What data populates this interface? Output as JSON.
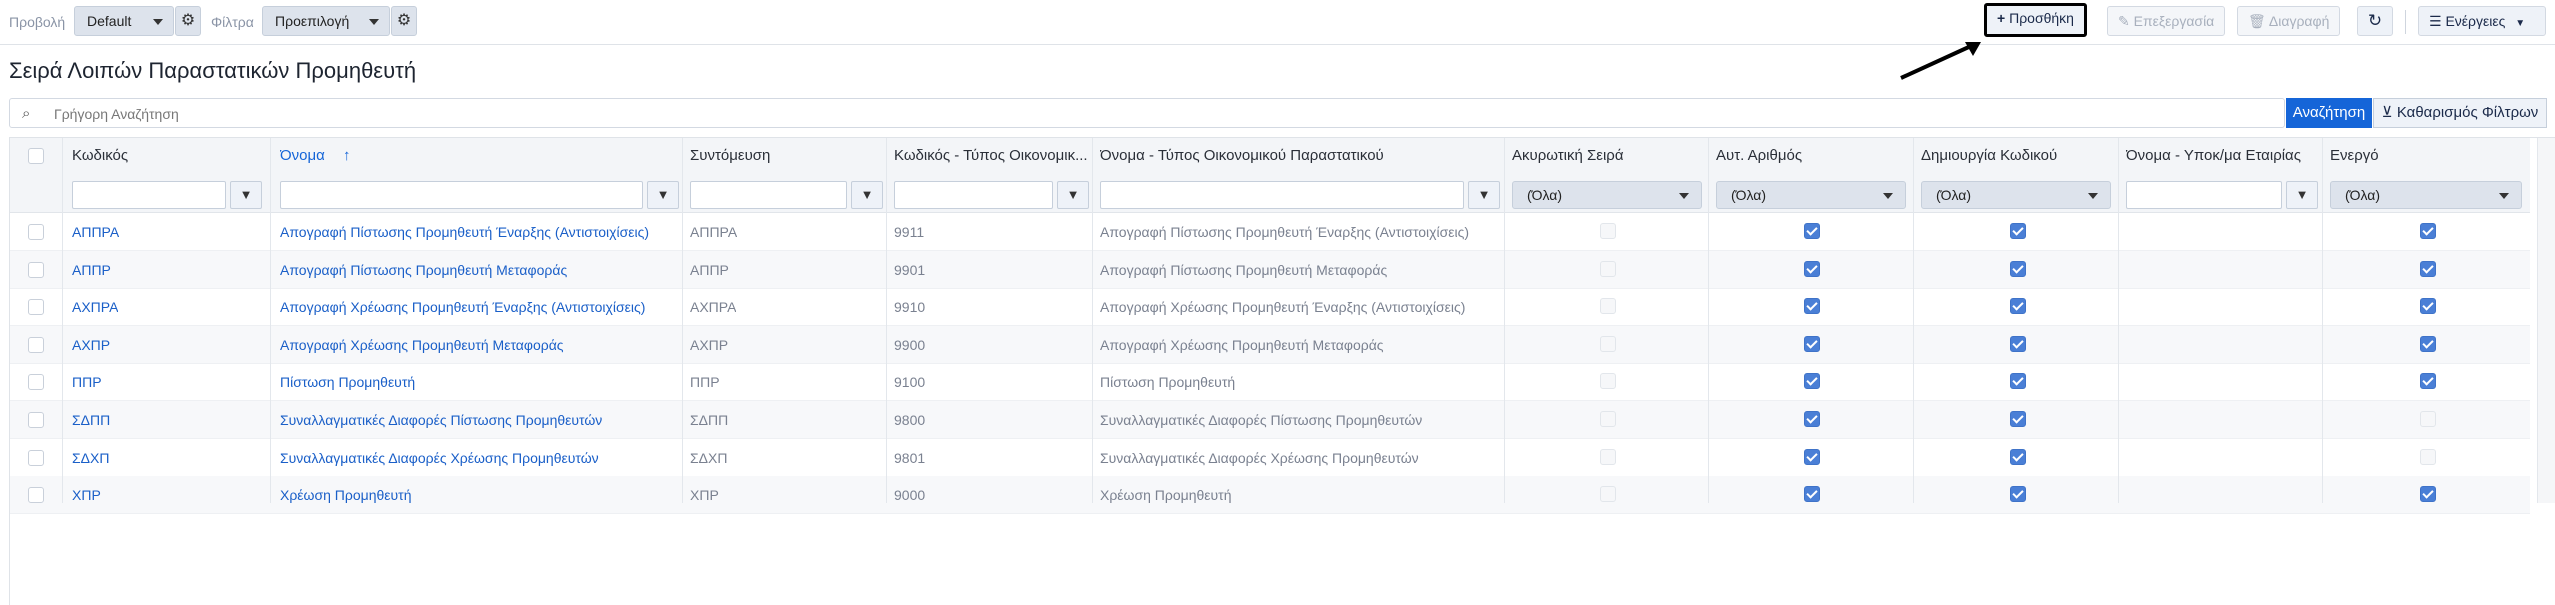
{
  "toolbar": {
    "view_label": "Προβολή",
    "view_value": "Default",
    "filters_label": "Φίλτρα",
    "filters_value": "Προεπιλογή",
    "add_label": "Προσθήκη",
    "edit_label": "Επεξεργασία",
    "delete_label": "Διαγραφή",
    "actions_label": "Ενέργειες"
  },
  "page": {
    "title": "Σειρά Λοιπών Παραστατικών Προμηθευτή"
  },
  "search": {
    "placeholder": "Γρήγορη Αναζήτηση",
    "search_button": "Αναζήτηση",
    "clear_filters_button": "Καθαρισμός Φίλτρων"
  },
  "grid": {
    "columns": [
      "Κωδικός",
      "Όνομα",
      "Συντόμευση",
      "Κωδικός - Τύπος Οικονομικ...",
      "Όνομα - Τύπος Οικονομικού Παραστατικού",
      "Ακυρωτική Σειρά",
      "Αυτ. Αριθμός",
      "Δημιουργία Κωδικού",
      "Όνομα - Υποκ/μα Εταιρίας",
      "Ενεργό"
    ],
    "sort_indicator": "↑",
    "filter_all": "(Όλα)",
    "rows": [
      {
        "code": "ΑΠΠΡΑ",
        "name": "Απογραφή Πίστωσης Προμηθευτή Έναρξης (Αντιστοιχίσεις)",
        "short": "ΑΠΠΡΑ",
        "type_code": "9911",
        "type_name": "Απογραφή Πίστωσης Προμηθευτή Έναρξης (Αντιστοιχίσεις)",
        "cancel": false,
        "auto": true,
        "create": true,
        "active": true
      },
      {
        "code": "ΑΠΠΡ",
        "name": "Απογραφή Πίστωσης Προμηθευτή Μεταφοράς",
        "short": "ΑΠΠΡ",
        "type_code": "9901",
        "type_name": "Απογραφή Πίστωσης Προμηθευτή Μεταφοράς",
        "cancel": false,
        "auto": true,
        "create": true,
        "active": true
      },
      {
        "code": "ΑΧΠΡΑ",
        "name": "Απογραφή Χρέωσης Προμηθευτή Έναρξης (Αντιστοιχίσεις)",
        "short": "ΑΧΠΡΑ",
        "type_code": "9910",
        "type_name": "Απογραφή Χρέωσης Προμηθευτή Έναρξης (Αντιστοιχίσεις)",
        "cancel": false,
        "auto": true,
        "create": true,
        "active": true
      },
      {
        "code": "ΑΧΠΡ",
        "name": "Απογραφή Χρέωσης Προμηθευτή Μεταφοράς",
        "short": "ΑΧΠΡ",
        "type_code": "9900",
        "type_name": "Απογραφή Χρέωσης Προμηθευτή Μεταφοράς",
        "cancel": false,
        "auto": true,
        "create": true,
        "active": true
      },
      {
        "code": "ΠΠΡ",
        "name": "Πίστωση Προμηθευτή",
        "short": "ΠΠΡ",
        "type_code": "9100",
        "type_name": "Πίστωση Προμηθευτή",
        "cancel": false,
        "auto": true,
        "create": true,
        "active": true
      },
      {
        "code": "ΣΔΠΠ",
        "name": "Συναλλαγματικές Διαφορές Πίστωσης Προμηθευτών",
        "short": "ΣΔΠΠ",
        "type_code": "9800",
        "type_name": "Συναλλαγματικές Διαφορές Πίστωσης Προμηθευτών",
        "cancel": false,
        "auto": true,
        "create": true,
        "active": false
      },
      {
        "code": "ΣΔΧΠ",
        "name": "Συναλλαγματικές Διαφορές Χρέωσης Προμηθευτών",
        "short": "ΣΔΧΠ",
        "type_code": "9801",
        "type_name": "Συναλλαγματικές Διαφορές Χρέωσης Προμηθευτών",
        "cancel": false,
        "auto": true,
        "create": true,
        "active": false
      },
      {
        "code": "ΧΠΡ",
        "name": "Χρέωση Προμηθευτή",
        "short": "ΧΠΡ",
        "type_code": "9000",
        "type_name": "Χρέωση Προμηθευτή",
        "cancel": false,
        "auto": true,
        "create": true,
        "active": true
      }
    ]
  },
  "colors": {
    "accent": "#1565d8",
    "checkbox": "#4a7fd6"
  },
  "icons": [
    "gear-icon",
    "plus-icon",
    "pencil-icon",
    "trash-icon",
    "refresh-icon",
    "menu-icon",
    "search-icon",
    "filter-icon",
    "filter-clear-icon",
    "arrow-annotation"
  ]
}
